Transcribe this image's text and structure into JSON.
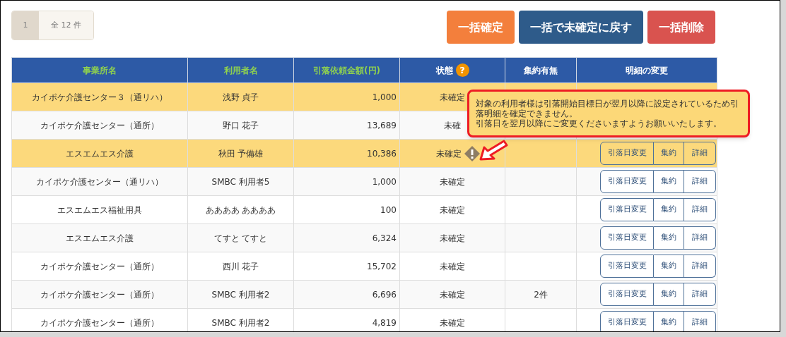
{
  "pagination": {
    "pages": [
      {
        "label": "1",
        "selected": true
      }
    ],
    "total": "全 12 件"
  },
  "actions": [
    {
      "label": "一括確定",
      "kind": "confirm"
    },
    {
      "label": "一括で未確定に戻す",
      "kind": "revert"
    },
    {
      "label": "一括削除",
      "kind": "delete"
    }
  ],
  "table": {
    "columns": [
      {
        "label": "事業所名",
        "accent": true
      },
      {
        "label": "利用者名",
        "accent": true
      },
      {
        "label": "引落依頼金額(円)",
        "accent": true
      },
      {
        "label": "状態",
        "accent": false,
        "help": "?"
      },
      {
        "label": "集約有無",
        "accent": false
      },
      {
        "label": "明細の変更",
        "accent": false
      }
    ],
    "rows": [
      {
        "office": "カイポケ介護センター３（通リハ）",
        "user": "浅野 貞子",
        "amount": "1,000",
        "status": "未確定",
        "warning": false,
        "highlighted": true
      },
      {
        "office": "カイポケ介護センター（通所）",
        "user": "野口 花子",
        "amount": "13,689",
        "status": "未確",
        "warning": false,
        "highlighted": false
      },
      {
        "office": "エスエムエス介護",
        "user": "秋田 予備雄",
        "amount": "10,386",
        "status": "未確定",
        "warning": true,
        "highlighted": true,
        "buttons": [
          "引落日変更",
          "集約",
          "詳細"
        ]
      },
      {
        "office": "カイポケ介護センター（通リハ）",
        "user": "SMBC 利用者5",
        "amount": "1,000",
        "status": "未確定",
        "warning": false,
        "highlighted": false,
        "buttons": [
          "引落日変更",
          "集約",
          "詳細"
        ]
      },
      {
        "office": "エスエムエス福祉用具",
        "user": "ああああ ああああ",
        "amount": "100",
        "status": "未確定",
        "warning": false,
        "highlighted": false,
        "buttons": [
          "引落日変更",
          "集約",
          "詳細"
        ]
      },
      {
        "office": "エスエムエス介護",
        "user": "てすと てすと",
        "amount": "6,324",
        "status": "未確定",
        "warning": false,
        "highlighted": false,
        "buttons": [
          "引落日変更",
          "集約",
          "詳細"
        ]
      },
      {
        "office": "カイポケ介護センター（通所）",
        "user": "西川 花子",
        "amount": "15,702",
        "status": "未確定",
        "warning": false,
        "highlighted": false,
        "buttons": [
          "引落日変更",
          "集約",
          "詳細"
        ]
      },
      {
        "office": "カイポケ介護センター（通所）",
        "user": "SMBC 利用者2",
        "amount": "6,696",
        "status": "未確定",
        "warning": false,
        "highlighted": false,
        "aggregate": "2件",
        "buttons": [
          "引落日変更",
          "集約",
          "詳細"
        ]
      },
      {
        "office": "カイポケ介護センター（通所）",
        "user": "SMBC 利用者2",
        "amount": "4,819",
        "status": "未確定",
        "warning": false,
        "highlighted": false,
        "buttons": [
          "引落日変更",
          "集約",
          "詳細"
        ]
      }
    ]
  },
  "tooltip": {
    "lines": [
      "対象の利用者様は引落開始目標日が翌月以降に設定されているため引落明細を確定できません。",
      "引落日を翌月以降にご変更くださいますようお願いいたします。"
    ]
  }
}
